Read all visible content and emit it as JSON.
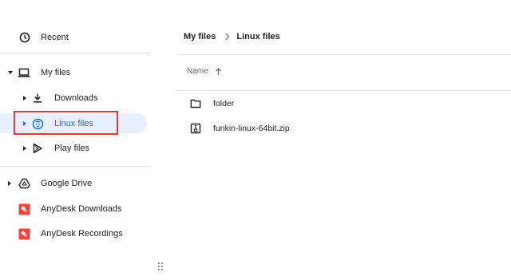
{
  "sidebar": {
    "recent": {
      "label": "Recent",
      "icon": "clock-icon"
    },
    "my_files": {
      "label": "My files",
      "icon": "laptop-icon"
    },
    "downloads": {
      "label": "Downloads",
      "icon": "download-icon"
    },
    "linux_files": {
      "label": "Linux files",
      "icon": "linux-icon"
    },
    "play_files": {
      "label": "Play files",
      "icon": "play-store-icon"
    },
    "google_drive": {
      "label": "Google Drive",
      "icon": "drive-icon"
    },
    "anydesk_downloads": {
      "label": "AnyDesk Downloads",
      "icon": "anydesk-icon"
    },
    "anydesk_recordings": {
      "label": "AnyDesk Recordings",
      "icon": "anydesk-icon"
    }
  },
  "breadcrumb": {
    "root": "My files",
    "current": "Linux files"
  },
  "columns": {
    "name": "Name"
  },
  "files": [
    {
      "name": "folder",
      "icon": "folder-icon"
    },
    {
      "name": "funkin-linux-64bit.zip",
      "icon": "zip-icon"
    }
  ],
  "colors": {
    "accent": "#1a73e8",
    "selection_bg": "#e8f0fe",
    "highlight_box": "#e53935",
    "anydesk": "#ef443b"
  }
}
